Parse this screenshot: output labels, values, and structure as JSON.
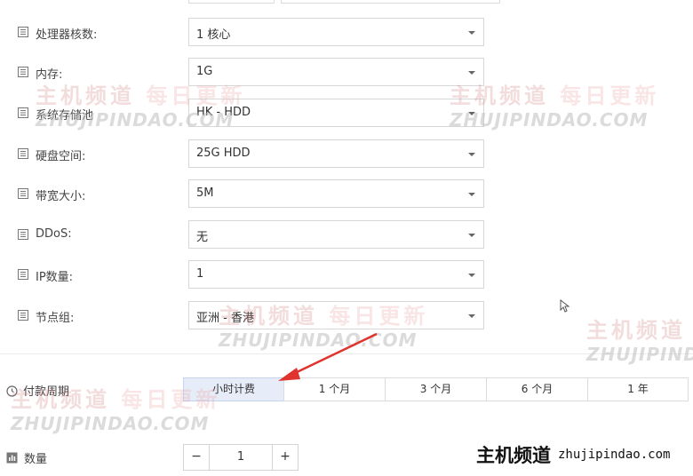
{
  "config_rows": [
    {
      "label": "处理器核数:",
      "value": "1 核心"
    },
    {
      "label": "内存:",
      "value": "1G"
    },
    {
      "label": "系统存储池",
      "value": "HK - HDD"
    },
    {
      "label": "硬盘空间:",
      "value": "25G HDD"
    },
    {
      "label": "带宽大小:",
      "value": "5M"
    },
    {
      "label": "DDoS:",
      "value": "无"
    },
    {
      "label": "IP数量:",
      "value": "1"
    },
    {
      "label": "节点组:",
      "value": "亚洲 - 香港"
    }
  ],
  "billing": {
    "label": "付款周期",
    "options": [
      "小时计费",
      "1 个月",
      "3 个月",
      "6 个月",
      "1 年"
    ],
    "selected": "小时计费"
  },
  "quantity": {
    "label": "数量",
    "minus": "−",
    "value": "1",
    "plus": "+"
  },
  "watermark": {
    "cn_dark": "主机频道",
    "cn_light": "每日更新",
    "en": "ZHUJIPINDAO.COM",
    "partial_cn_light": "每",
    "partial_en": "ZHUJIPINDA"
  },
  "brand": {
    "name": "主机频道",
    "url": "zhujipindao.com"
  },
  "colors": {
    "arrow": "#e0332e",
    "selected_tab_bg": "#e6edf9"
  }
}
